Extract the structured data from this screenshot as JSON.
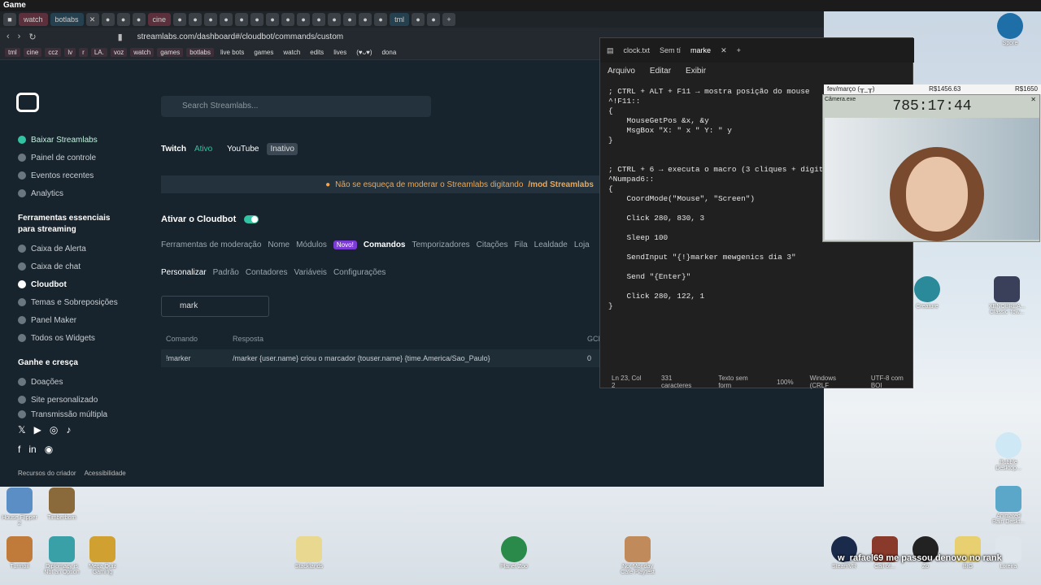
{
  "window_title": "Game",
  "browser": {
    "tabs": [
      "watch",
      "botlabs",
      "cine",
      "tml"
    ],
    "url": "streamlabs.com/dashboard#/cloudbot/commands/custom",
    "bookmarks": [
      "tml",
      "cine",
      "ccz",
      "lv",
      "r",
      "LA.",
      "voz",
      "watch",
      "games",
      "botlabs",
      "live bots",
      "games",
      "watch",
      "edits",
      "lives",
      "(♥ᴗ♥)",
      "dona"
    ]
  },
  "sidebar": {
    "items": [
      {
        "label": "Baixar Streamlabs"
      },
      {
        "label": "Painel de controle"
      },
      {
        "label": "Eventos recentes"
      },
      {
        "label": "Analytics"
      }
    ],
    "section1": "Ferramentas essenciais para streaming",
    "tools": [
      {
        "label": "Caixa de Alerta"
      },
      {
        "label": "Caixa de chat"
      },
      {
        "label": "Cloudbot"
      },
      {
        "label": "Temas e Sobreposições"
      },
      {
        "label": "Panel Maker"
      },
      {
        "label": "Todos os Widgets"
      }
    ],
    "section2": "Ganhe e cresça",
    "earn": [
      {
        "label": "Doações"
      },
      {
        "label": "Site personalizado"
      },
      {
        "label": "Transmissão múltipla"
      }
    ],
    "footer_left": "Recursos do criador",
    "footer_right": "Acessibilidade"
  },
  "main": {
    "search_placeholder": "Search Streamlabs...",
    "twitch_label": "Twitch",
    "twitch_status": "Ativo",
    "youtube_label": "YouTube",
    "youtube_status": "Inativo",
    "notice": "Não se esqueça de moderar o Streamlabs digitando",
    "notice_cmd": "/mod Streamlabs",
    "cloudbot_toggle": "Ativar o Cloudbot",
    "nav": [
      "Ferramentas de moderação",
      "Nome",
      "Módulos",
      "Comandos",
      "Temporizadores",
      "Citações",
      "Fila",
      "Lealdade",
      "Loja"
    ],
    "novo_badge": "Novo!",
    "subnav": [
      "Personalizar",
      "Padrão",
      "Contadores",
      "Variáveis",
      "Configurações"
    ],
    "filter_value": "mark",
    "table_headers": {
      "command": "Comando",
      "response": "Resposta",
      "gcd": "GCD"
    },
    "row": {
      "command": "!marker",
      "response": "/marker {user.name} criou o marcador {touser.name} {time.America/Sao_Paulo}",
      "gcd": "0"
    }
  },
  "notepad": {
    "tabs": [
      "clock.txt",
      "Sem tí",
      "marke"
    ],
    "menu": [
      "Arquivo",
      "Editar",
      "Exibir"
    ],
    "lines": [
      "; CTRL + ALT + F11 → mostra posição do mouse",
      "^!F11::",
      "{",
      "    MouseGetPos &x, &y",
      "    MsgBox \"X: \" x \" Y: \" y",
      "}",
      "",
      "",
      "; CTRL + 6 → executa o macro (3 cliques + digita)",
      "^Numpad6::",
      "{",
      "    CoordMode(\"Mouse\", \"Screen\")",
      "",
      "    Click 280, 830, 3",
      "",
      "    Sleep 100",
      "",
      "    SendInput \"{!}marker mewgenics dia 3\"",
      "",
      "    Send \"{Enter}\"",
      "",
      "    Click 280, 122, 1",
      "}"
    ],
    "status": [
      "Ln 23, Col 2",
      "331 caracteres",
      "Texto sem form",
      "100%",
      "Windows (CRLF",
      "UTF-8 com BOI"
    ]
  },
  "overlay": {
    "goal": "fev/março (╥_╥)",
    "amount1": "R$1456.63",
    "amount2": "R$1650",
    "camera_label": "Câmera.exe",
    "clock": "785:17:44"
  },
  "desktop": {
    "icons": [
      "House Flipper 2",
      "Timberborn",
      "Turmoil",
      "Diplomacy is Not an Option",
      "Mega Quiz Gaming",
      "Stacklands",
      "Planet Zoo",
      "Not Monday Cafe Playtest",
      "SteamVR",
      "Call of...",
      "Zo",
      "BtG",
      "Lixeira",
      "Spore",
      "Creature",
      "XENOBREA... Classic Tow...",
      "Bubble Desktop...",
      "Animated Rain Deskt..."
    ],
    "chat": "w_rafael69 me passou denovo no rank"
  }
}
